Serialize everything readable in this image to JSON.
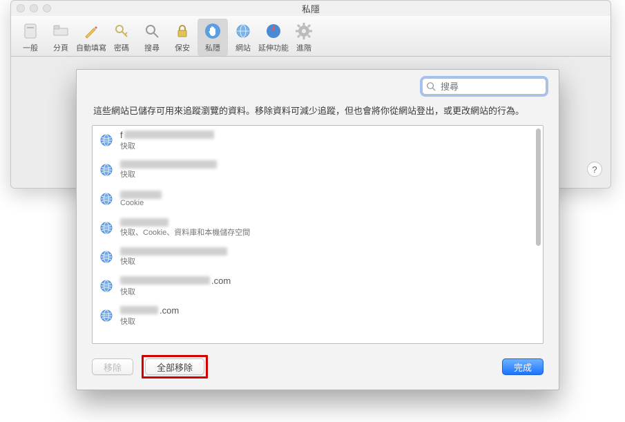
{
  "window": {
    "title": "私隱"
  },
  "toolbar": {
    "items": [
      {
        "label": "一般",
        "icon": "general"
      },
      {
        "label": "分頁",
        "icon": "tabs"
      },
      {
        "label": "自動填寫",
        "icon": "autofill"
      },
      {
        "label": "密碼",
        "icon": "passwords"
      },
      {
        "label": "搜尋",
        "icon": "search"
      },
      {
        "label": "保安",
        "icon": "security"
      },
      {
        "label": "私隱",
        "icon": "privacy",
        "selected": true
      },
      {
        "label": "網站",
        "icon": "websites"
      },
      {
        "label": "延伸功能",
        "icon": "extensions"
      },
      {
        "label": "進階",
        "icon": "advanced"
      }
    ],
    "help_label": "?"
  },
  "sheet": {
    "search_placeholder": "搜尋",
    "description": "這些網站已儲存可用來追蹤瀏覽的資料。移除資料可減少追蹤，但也會將你從網站登出，或更改網站的行為。",
    "items": [
      {
        "domain_prefix": "f",
        "domain_suffix": "",
        "redacted_width": 130,
        "sub": "快取"
      },
      {
        "domain_prefix": "",
        "domain_suffix": "",
        "redacted_width": 140,
        "sub": "快取"
      },
      {
        "domain_prefix": "",
        "domain_suffix": "",
        "redacted_width": 60,
        "sub": "Cookie"
      },
      {
        "domain_prefix": "",
        "domain_suffix": "",
        "redacted_width": 70,
        "sub": "快取、Cookie、資料庫和本機儲存空間"
      },
      {
        "domain_prefix": "",
        "domain_suffix": "",
        "redacted_width": 155,
        "sub": "快取"
      },
      {
        "domain_prefix": "",
        "domain_suffix": ".com",
        "redacted_width": 130,
        "sub": "快取"
      },
      {
        "domain_prefix": "",
        "domain_suffix": ".com",
        "redacted_width": 55,
        "sub": "快取"
      }
    ],
    "buttons": {
      "remove": "移除",
      "remove_all": "全部移除",
      "done": "完成"
    }
  }
}
